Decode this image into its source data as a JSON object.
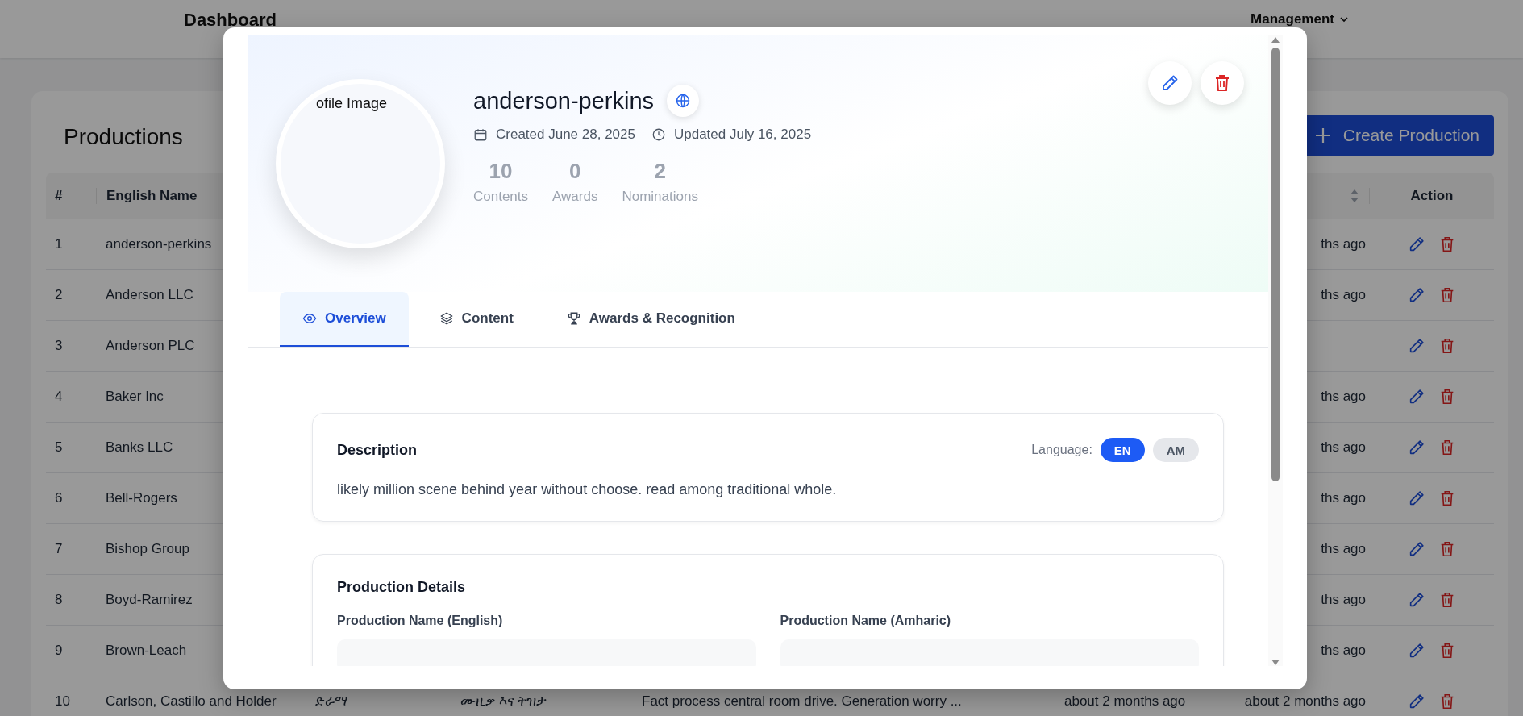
{
  "header": {
    "title": "Dashboard",
    "nav": [
      {
        "label": "Management"
      }
    ]
  },
  "page": {
    "title": "Productions",
    "create_button": "Create Production"
  },
  "table": {
    "columns": {
      "number": "#",
      "english_name": "English Name",
      "action": "Action"
    },
    "rows": [
      {
        "number": "1",
        "english_name": "anderson-perkins",
        "column_7": "ths ago"
      },
      {
        "number": "2",
        "english_name": "Anderson LLC",
        "column_7": "ths ago"
      },
      {
        "number": "3",
        "english_name": "Anderson PLC"
      },
      {
        "number": "4",
        "english_name": "Baker Inc",
        "column_7": "ths ago"
      },
      {
        "number": "5",
        "english_name": "Banks LLC",
        "column_7": "ths ago"
      },
      {
        "number": "6",
        "english_name": "Bell-Rogers",
        "column_7": "ths ago"
      },
      {
        "number": "7",
        "english_name": "Bishop Group",
        "column_7": "ths ago"
      },
      {
        "number": "8",
        "english_name": "Boyd-Ramirez",
        "column_7": "ths ago"
      },
      {
        "number": "9",
        "english_name": "Brown-Leach",
        "column_7": "ths ago"
      },
      {
        "number": "10",
        "english_name": "Carlson, Castillo and Holder",
        "column_3": "ድራማ",
        "column_4": "ሙዚቃ እና ትዝታ",
        "column_5": "Fact process central room drive. Generation worry ...",
        "column_6": "about 2 months ago",
        "column_7": "about 2 months ago"
      }
    ]
  },
  "modal": {
    "image_alt": "ofile Image",
    "name": "anderson-perkins",
    "created": "Created June 28, 2025",
    "updated": "Updated July 16, 2025",
    "stats": [
      {
        "value": "10",
        "label": "Contents"
      },
      {
        "value": "0",
        "label": "Awards"
      },
      {
        "value": "2",
        "label": "Nominations"
      }
    ],
    "tabs": [
      {
        "label": "Overview",
        "selected": true
      },
      {
        "label": "Content",
        "selected": false
      },
      {
        "label": "Awards & Recognition",
        "selected": false
      }
    ],
    "description": {
      "title": "Description",
      "language_label": "Language:",
      "languages": [
        {
          "label": "EN",
          "selected": true
        },
        {
          "label": "AM",
          "selected": false
        }
      ],
      "text": "likely million scene behind year without choose. read among traditional whole."
    },
    "details": {
      "title": "Production Details",
      "fields": [
        {
          "label": "Production Name (English)"
        },
        {
          "label": "Production Name (Amharic)"
        }
      ]
    }
  }
}
